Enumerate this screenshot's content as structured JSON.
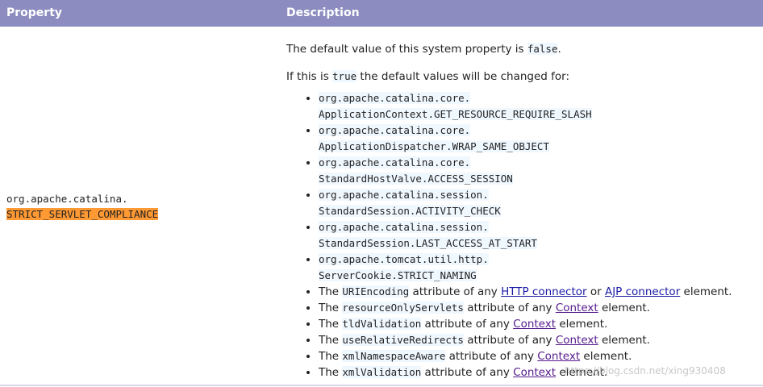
{
  "header": {
    "property_label": "Property",
    "description_label": "Description"
  },
  "property": {
    "line1": "org.apache.catalina.",
    "line2": "STRICT_SERVLET_COMPLIANCE"
  },
  "description": {
    "p1_pre": "The default value of this system property is ",
    "p1_code": "false",
    "p1_post": ".",
    "p2_pre": "If this is ",
    "p2_code": "true",
    "p2_post": " the default values will be changed for:",
    "code_items": [
      {
        "line1": "org.apache.catalina.core.",
        "line2": "ApplicationContext.GET_RESOURCE_REQUIRE_SLASH"
      },
      {
        "line1": "org.apache.catalina.core.",
        "line2": "ApplicationDispatcher.WRAP_SAME_OBJECT"
      },
      {
        "line1": "org.apache.catalina.core.",
        "line2": "StandardHostValve.ACCESS_SESSION"
      },
      {
        "line1": "org.apache.catalina.session.",
        "line2": "StandardSession.ACTIVITY_CHECK"
      },
      {
        "line1": "org.apache.catalina.session.",
        "line2": "StandardSession.LAST_ACCESS_AT_START"
      },
      {
        "line1": "org.apache.tomcat.util.http.",
        "line2": "ServerCookie.STRICT_NAMING"
      }
    ],
    "uri_item": {
      "pre": "The ",
      "code": "URIEncoding",
      "mid": " attribute of any ",
      "link1": "HTTP connector",
      "or": " or ",
      "link2": "AJP connector",
      "post": " element."
    },
    "attr_items": [
      {
        "pre": "The ",
        "code": "resourceOnlyServlets",
        "mid": " attribute of any ",
        "link": "Context",
        "post": " element."
      },
      {
        "pre": "The ",
        "code": "tldValidation",
        "mid": " attribute of any ",
        "link": "Context",
        "post": " element."
      },
      {
        "pre": "The ",
        "code": "useRelativeRedirects",
        "mid": " attribute of any ",
        "link": "Context",
        "post": " element."
      },
      {
        "pre": "The ",
        "code": "xmlNamespaceAware",
        "mid": " attribute of any ",
        "link": "Context",
        "post": " element."
      },
      {
        "pre": "The ",
        "code": "xmlValidation",
        "mid": " attribute of any ",
        "link": "Context",
        "post": " element."
      }
    ]
  },
  "watermark": "https://blog.csdn.net/xing930408"
}
